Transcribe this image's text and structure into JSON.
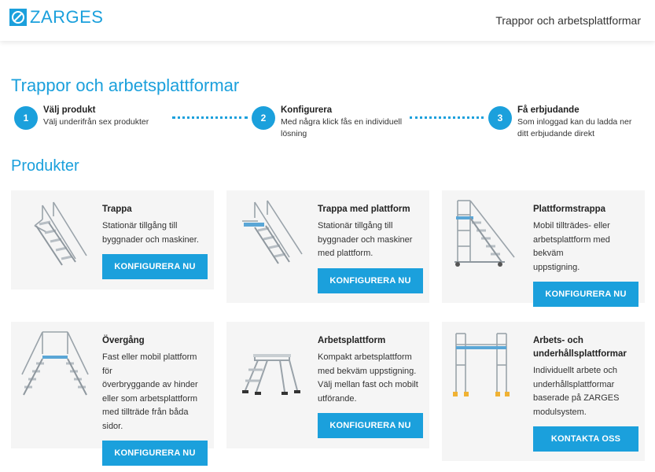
{
  "header": {
    "brand": "ZARGES",
    "logo_icon": "zarges-logo-icon",
    "title": "Trappor och arbetsplattformar"
  },
  "page_title": "Trappor och arbetsplattformar",
  "steps": [
    {
      "number": "1",
      "title": "Välj produkt",
      "desc_lines": [
        "Välj underifrån sex produkter"
      ]
    },
    {
      "number": "2",
      "title": "Konfigurera",
      "desc_lines": [
        "Med några klick fås en individuell",
        "lösning"
      ]
    },
    {
      "number": "3",
      "title": "Få erbjudande",
      "desc_lines": [
        "Som inloggad kan du ladda ner",
        "ditt erbjudande direkt"
      ]
    }
  ],
  "section_title": "Produkter",
  "products": [
    {
      "title": "Trappa",
      "desc_lines": [
        "Stationär tillgång till",
        "byggnader och maskiner."
      ],
      "button": "KONFIGURERA NU",
      "icon": "stair-icon"
    },
    {
      "title": "Trappa med plattform",
      "desc_lines": [
        "Stationär tillgång till",
        "byggnader och maskiner",
        "med plattform."
      ],
      "button": "KONFIGURERA NU",
      "icon": "stair-with-platform-icon"
    },
    {
      "title": "Plattformstrappa",
      "desc_lines": [
        "Mobil tillträdes- eller",
        "arbetsplattform med bekväm",
        "uppstigning."
      ],
      "button": "KONFIGURERA NU",
      "icon": "platform-stair-icon"
    },
    {
      "title": "Övergång",
      "desc_lines": [
        "Fast eller mobil plattform för",
        "överbryggande av hinder",
        "eller som arbetsplattform",
        "med tillträde från båda sidor."
      ],
      "button": "KONFIGURERA NU",
      "icon": "crossover-icon"
    },
    {
      "title": "Arbetsplattform",
      "desc_lines": [
        "Kompakt arbetsplattform",
        "med bekväm uppstigning.",
        "Välj mellan fast och mobilt",
        "utförande."
      ],
      "button": "KONFIGURERA NU",
      "icon": "work-platform-icon"
    },
    {
      "title_lines": [
        "Arbets- och",
        "underhållsplattformar"
      ],
      "desc_lines": [
        "Individuellt arbete och",
        "underhållsplattformar",
        "baserade på ZARGES",
        "modulsystem."
      ],
      "button": "KONTAKTA OSS",
      "icon": "maintenance-platform-icon"
    }
  ],
  "colors": {
    "accent": "#1ba0dc",
    "card_bg": "#f5f5f5"
  }
}
